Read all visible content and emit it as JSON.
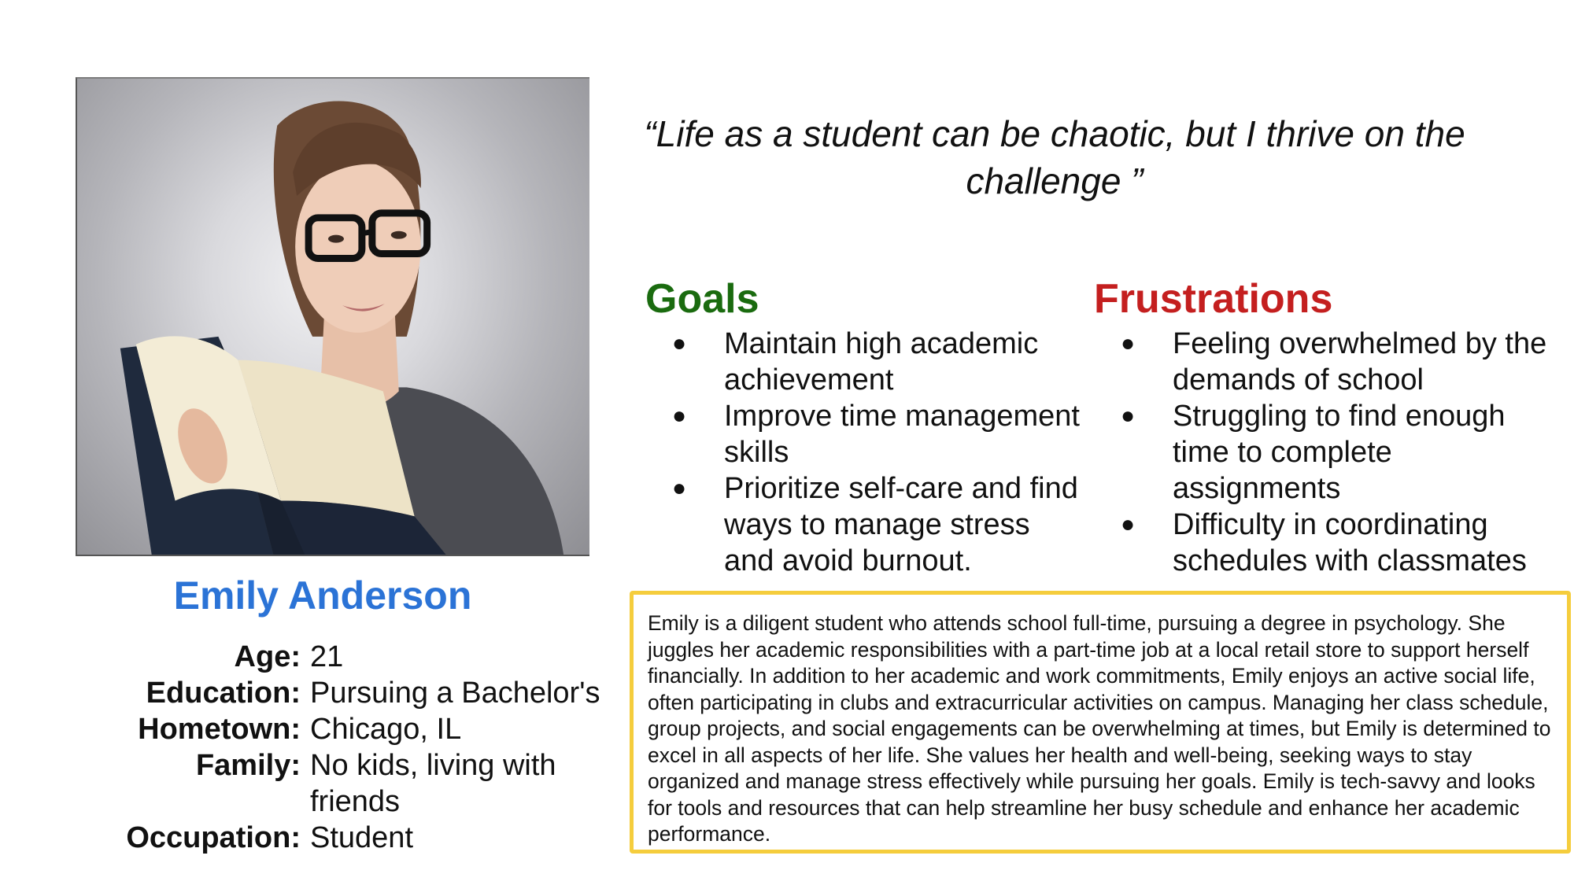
{
  "persona": {
    "name": "Emily Anderson",
    "quote": "“Life as a student can be chaotic, but I thrive on the challenge ”",
    "details": [
      {
        "label": "Age:",
        "value": "21"
      },
      {
        "label": "Education:",
        "value": "Pursuing a Bachelor's"
      },
      {
        "label": "Hometown:",
        "value": "Chicago, IL"
      },
      {
        "label": "Family:",
        "value": "No kids, living with friends"
      },
      {
        "label": "Occupation:",
        "value": "Student"
      }
    ]
  },
  "goals": {
    "title": "Goals",
    "items": [
      "Maintain high academic achievement",
      "Improve time management skills",
      "Prioritize self-care and find ways to manage stress and avoid burnout."
    ]
  },
  "frustrations": {
    "title": "Frustrations",
    "items": [
      "Feeling overwhelmed by the demands of school",
      "Struggling to find enough time to complete assignments",
      "Difficulty in coordinating schedules with classmates"
    ]
  },
  "bio": {
    "text": "Emily is a diligent student who attends school full-time, pursuing a degree in psychology. She juggles her academic responsibilities with a part-time job at a local retail store to support herself financially. In addition to her academic and work commitments, Emily enjoys an active social life, often participating in clubs and extracurricular activities on campus. Managing her class schedule, group projects, and social engagements can be overwhelming at times, but Emily is determined to excel in all aspects of her life. She values her health and well-being, seeking ways to stay organized and manage stress effectively while pursuing her goals. Emily is tech-savvy and looks for tools and resources that can help streamline her busy schedule and enhance her academic performance."
  },
  "colors": {
    "name": "#2b73d6",
    "goals": "#1a6b0f",
    "frustrations": "#c41f1f",
    "bio_border": "#f5cd3d"
  },
  "icons": {
    "bullet": "●"
  }
}
